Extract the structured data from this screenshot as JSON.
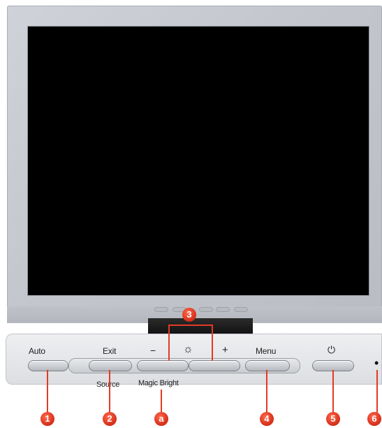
{
  "controls": {
    "auto_label": "Auto",
    "exit_label": "Exit",
    "source_label": "Source",
    "minus_label": "−",
    "brightness_label": "☼",
    "plus_label": "+",
    "magic_bright_label": "Magic Bright",
    "menu_label": "Menu",
    "power_label": "⏻",
    "led_label": "•"
  },
  "callouts": {
    "c1": "1",
    "c2": "2",
    "c3": "3",
    "ca": "a",
    "c4": "4",
    "c5": "5",
    "c6": "6"
  },
  "colors": {
    "callout": "#e23a26",
    "screen": "#000000",
    "bezel": "#c3c7cd"
  }
}
